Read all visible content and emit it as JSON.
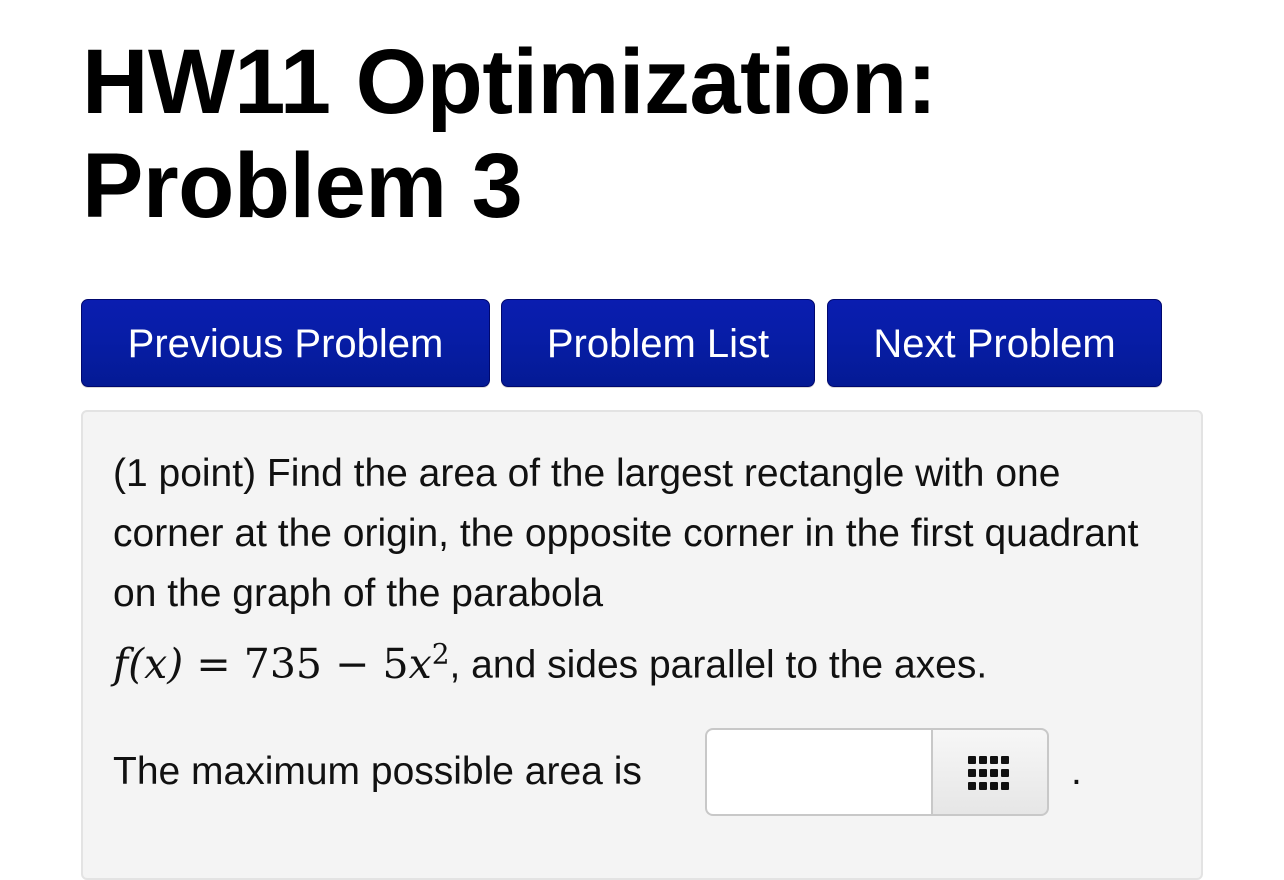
{
  "page": {
    "title_line1": "HW11 Optimization:",
    "title_line2": "Problem 3"
  },
  "nav": {
    "previous_label": "Previous Problem",
    "list_label": "Problem List",
    "next_label": "Next Problem"
  },
  "problem": {
    "points": "(1 point)",
    "text_part1": "Find the area of the largest rectangle with one corner at the origin, the opposite corner in the first quadrant on the graph of the parabola",
    "formula_lhs": "f(x)",
    "formula_equals": "=",
    "formula_rhs_const": "735",
    "formula_minus": "−",
    "formula_coef": "5",
    "formula_var": "x",
    "formula_exp": "2",
    "text_part2": ", and sides parallel to the axes.",
    "answer_label": "The maximum possible area is",
    "answer_value": "",
    "answer_suffix": ".",
    "keypad_icon": "keypad-icon"
  },
  "colors": {
    "button_blue": "#071da6",
    "box_background": "#f4f4f4"
  }
}
